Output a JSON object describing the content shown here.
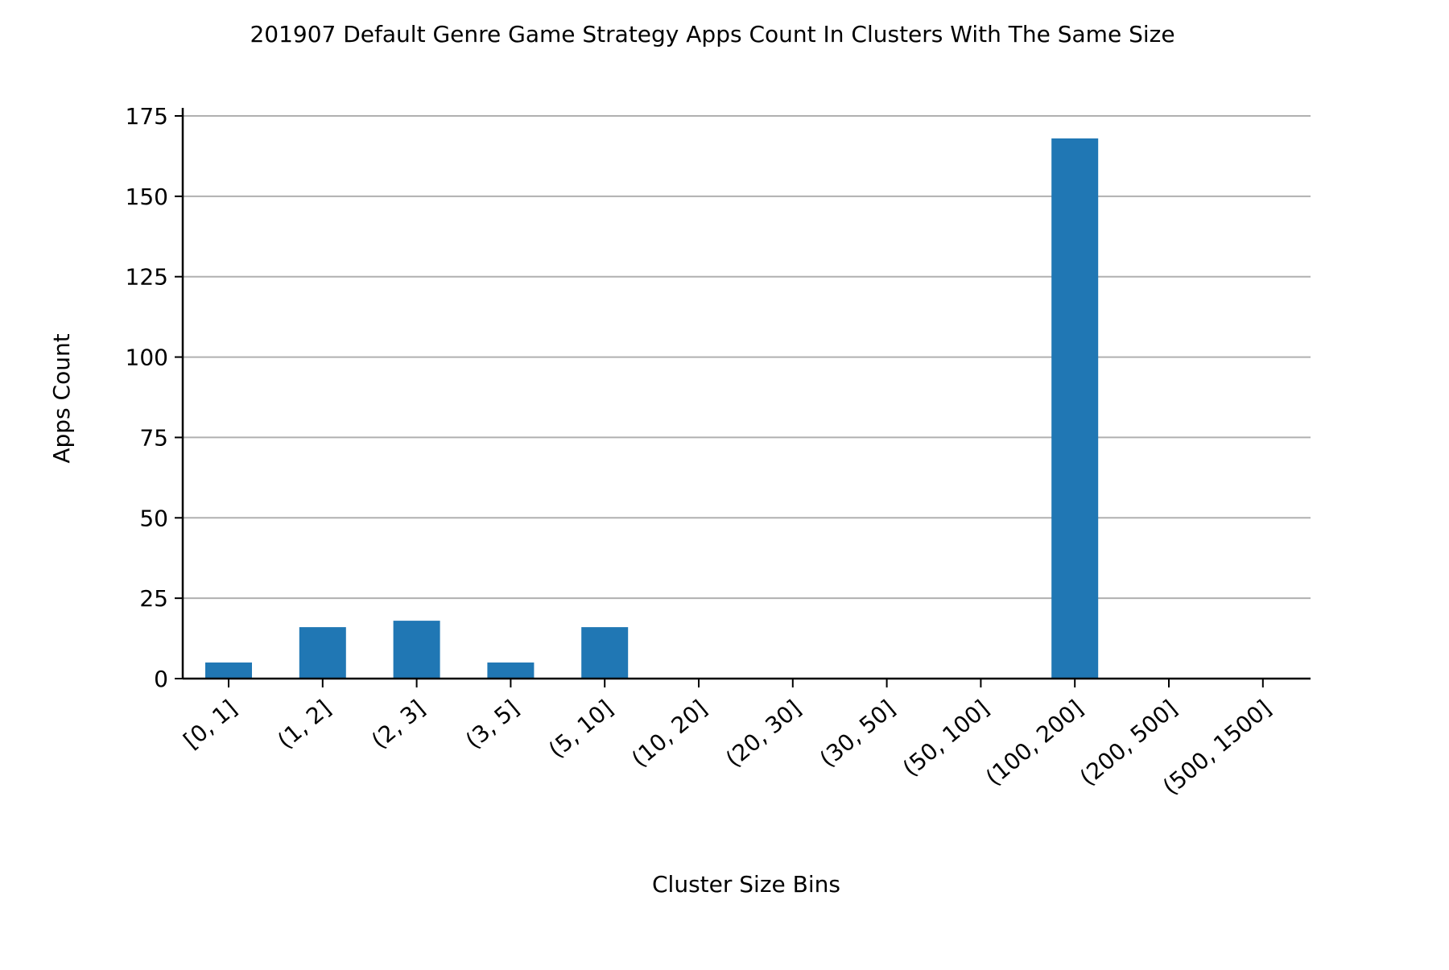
{
  "chart_data": {
    "type": "bar",
    "title": "201907 Default Genre Game Strategy Apps Count In Clusters With The Same Size",
    "xlabel": "Cluster Size Bins",
    "ylabel": "Apps Count",
    "categories": [
      "[0, 1]",
      "(1, 2]",
      "(2, 3]",
      "(3, 5]",
      "(5, 10]",
      "(10, 20]",
      "(20, 30]",
      "(30, 50]",
      "(50, 100]",
      "(100, 200]",
      "(200, 500]",
      "(500, 1500]"
    ],
    "values": [
      5,
      16,
      18,
      5,
      16,
      0,
      0,
      0,
      0,
      168,
      0,
      0
    ],
    "yticks": [
      0,
      25,
      50,
      75,
      100,
      125,
      150,
      175
    ],
    "ylim": [
      0,
      176
    ],
    "grid": "horizontal",
    "colors": {
      "bar": "#2077b4",
      "grid": "#b0b0b0",
      "axis": "#000000"
    }
  }
}
